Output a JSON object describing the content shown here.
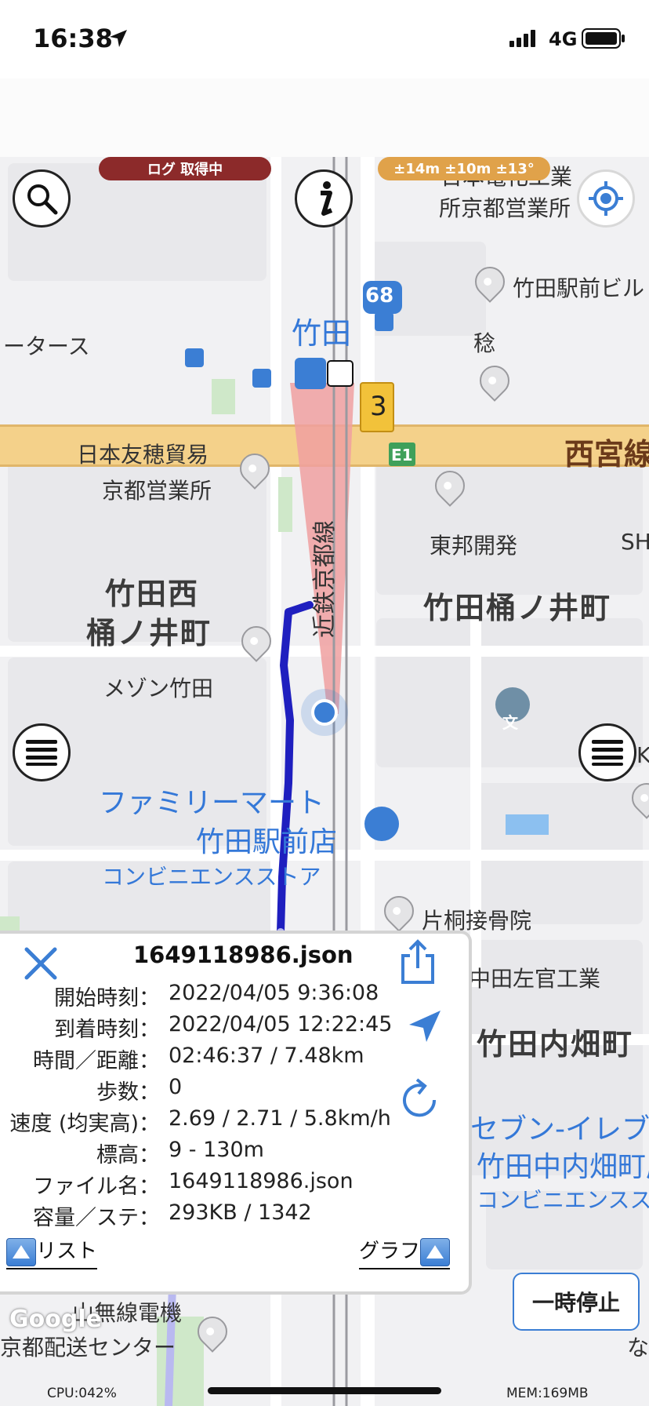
{
  "status": {
    "time": "16:38",
    "network": "4G"
  },
  "pills": {
    "log_status": "ログ 取得中",
    "accuracy": "±14m ±10m ±13°"
  },
  "map": {
    "labels": {
      "nihon_denka": "日本電化工業",
      "shokyoto": "所京都営業所",
      "takeda_ekimae_bil": "竹田駅前ビル",
      "takeda": "竹田",
      "motors": "ータース",
      "inaho": "稔",
      "route_68": "68",
      "route_3": "3",
      "e1": "E1",
      "nishimiya": "西宮線",
      "nihon_yuho": "日本友穂貿易",
      "kyoto_eigyo": "京都営業所",
      "kintetsu": "近鉄京都線",
      "toho": "東邦開発",
      "sh": "SH",
      "takeda_nishi_1": "竹田西",
      "takeda_nishi_2": "桶ノ井町",
      "takeda_okenoi": "竹田桶ノ井町",
      "maison": "メゾン竹田",
      "school": "文",
      "famima_1": "ファミリーマート",
      "famima_2": "竹田駅前店",
      "convenience_1": "コンビニエンスストア",
      "katagiri": "片桐接骨院",
      "sakon": "中田左官工業",
      "uchihata": "竹田内畑町",
      "seven_1": "セブン-イレブン 京都",
      "seven_2": "竹田中内畑町店",
      "convenience_2": "コンビニエンスストア",
      "musen": "山無線電機",
      "haiso": "京都配送センター",
      "na": "な",
      "google": "Google",
      "ka": "Ka"
    }
  },
  "panel": {
    "title": "1649118986.json",
    "rows": [
      {
        "label": "開始時刻：",
        "value": "2022/04/05 9:36:08"
      },
      {
        "label": "到着時刻：",
        "value": "2022/04/05 12:22:45"
      },
      {
        "label": "時間／距離：",
        "value": "02:46:37 / 7.48km"
      },
      {
        "label": "歩数：",
        "value": "0"
      },
      {
        "label": "速度 (均実高)：",
        "value": "2.69 / 2.71 / 5.8km/h"
      },
      {
        "label": "標高：",
        "value": "9 - 130m"
      },
      {
        "label": "ファイル名：",
        "value": "1649118986.json"
      },
      {
        "label": "容量／ステ：",
        "value": "293KB / 1342"
      }
    ],
    "list_label": "リスト",
    "graph_label": "グラフ"
  },
  "pause_label": "一時停止",
  "footer": {
    "cpu": "CPU:042%",
    "mem": "MEM:169MB"
  },
  "colors": {
    "track_dark": "#1f1fbf",
    "track_light": "#b9b9f0",
    "railway_highlight": "#f0a0a0",
    "highway": "#f4d18a",
    "accent_blue": "#3b7ed4",
    "log_pill": "#8c2a2a",
    "accuracy_pill": "#e0a24a"
  }
}
